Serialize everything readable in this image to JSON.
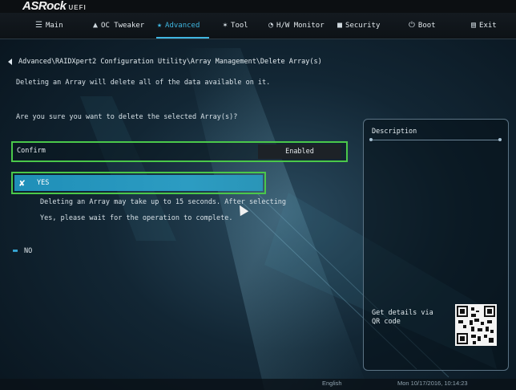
{
  "brand": {
    "name": "ASRock",
    "suffix": "UEFI"
  },
  "menu": [
    {
      "label": "Main",
      "icon": "list-icon",
      "glyph": "☰"
    },
    {
      "label": "OC Tweaker",
      "icon": "rocket-icon",
      "glyph": "▲"
    },
    {
      "label": "Advanced",
      "icon": "star-icon",
      "glyph": "★",
      "active": true
    },
    {
      "label": "Tool",
      "icon": "wrench-icon",
      "glyph": "✶"
    },
    {
      "label": "H/W Monitor",
      "icon": "monitor-icon",
      "glyph": "◔"
    },
    {
      "label": "Security",
      "icon": "shield-icon",
      "glyph": "■"
    },
    {
      "label": "Boot",
      "icon": "power-icon",
      "glyph": "⏻"
    },
    {
      "label": "Exit",
      "icon": "exit-icon",
      "glyph": "▤"
    }
  ],
  "breadcrumb": "Advanced\\RAIDXpert2 Configuration Utility\\Array Management\\Delete Array(s)",
  "info_text": "Deleting an Array will delete all of the data available on it.",
  "question": "Are you sure you want to delete the selected Array(s)?",
  "confirm": {
    "label": "Confirm",
    "value": "Enabled"
  },
  "yes_option": {
    "label": "YES",
    "icon": "tools-icon",
    "glyph": "✘",
    "desc_line1": "Deleting an Array may take up to 15 seconds. After selecting",
    "desc_line2": "Yes, please wait for the operation to complete."
  },
  "no_option": {
    "label": "NO",
    "icon": "folder-icon",
    "glyph": "▬"
  },
  "description_panel": {
    "title": "Description",
    "qr_text": "Get details via QR code"
  },
  "status": {
    "language": "English",
    "datetime": "Mon 10/17/2016, 10:14:23"
  },
  "colors": {
    "accent": "#3fb6e0",
    "highlight_border": "#4ac84a",
    "selected_fill": "#2596be"
  }
}
